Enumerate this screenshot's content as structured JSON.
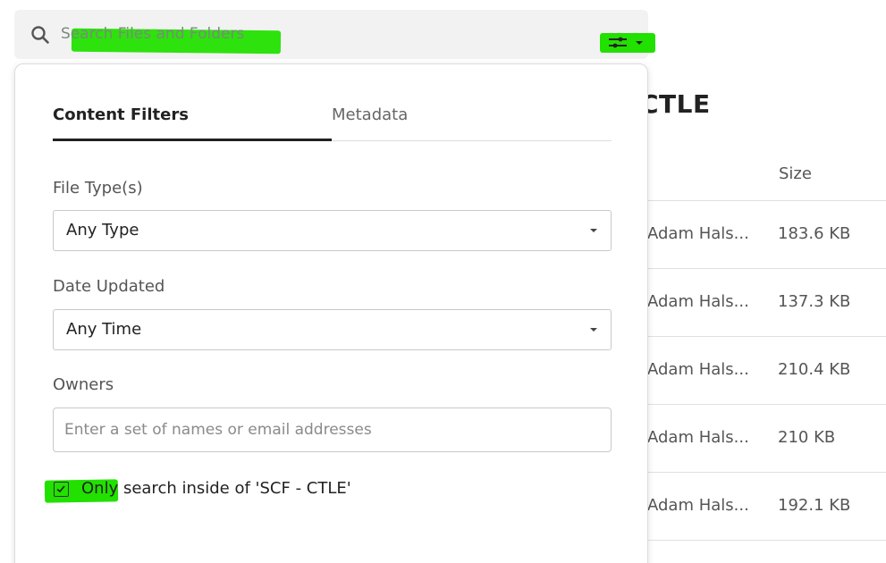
{
  "search": {
    "placeholder": "Search Files and Folders"
  },
  "background": {
    "title": "CTLE",
    "size_header": "Size",
    "rows": [
      {
        "owner": "Adam Hals...",
        "size": "183.6 KB"
      },
      {
        "owner": "Adam Hals...",
        "size": "137.3 KB"
      },
      {
        "owner": "Adam Hals...",
        "size": "210.4 KB"
      },
      {
        "owner": "Adam Hals...",
        "size": "210 KB"
      },
      {
        "owner": "Adam Hals...",
        "size": "192.1 KB"
      }
    ]
  },
  "filters": {
    "tabs": [
      {
        "label": "Content Filters",
        "active": true
      },
      {
        "label": "Metadata",
        "active": false
      }
    ],
    "file_type": {
      "label": "File Type(s)",
      "value": "Any Type"
    },
    "date_updated": {
      "label": "Date Updated",
      "value": "Any Time"
    },
    "owners": {
      "label": "Owners",
      "placeholder": "Enter a set of names or email addresses",
      "value": ""
    },
    "scope": {
      "label": "Only search inside of 'SCF - CTLE'",
      "checked": true
    }
  },
  "colors": {
    "highlight": "#22e000",
    "search_bg": "#f2f2f2",
    "text_primary": "#222222",
    "text_secondary": "#555555"
  },
  "icons": {
    "search": "search-icon",
    "filter": "sliders-icon",
    "caret": "caret-down-icon",
    "check": "check-icon"
  }
}
